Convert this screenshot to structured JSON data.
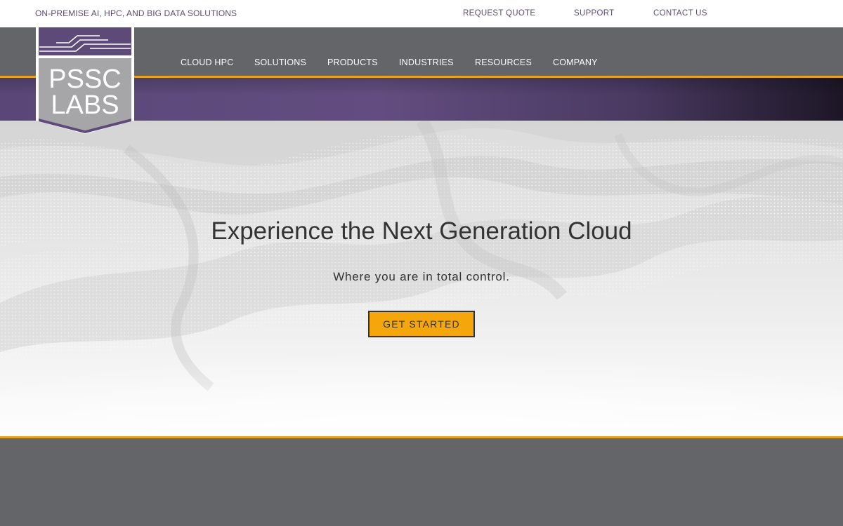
{
  "topbar": {
    "tagline": "ON-PREMISE AI, HPC, AND BIG DATA SOLUTIONS",
    "links": [
      "REQUEST QUOTE",
      "SUPPORT",
      "CONTACT US"
    ]
  },
  "logo": {
    "line1": "PSSC",
    "line2": "LABS"
  },
  "nav": {
    "items": [
      "CLOUD HPC",
      "SOLUTIONS",
      "PRODUCTS",
      "INDUSTRIES",
      "RESOURCES",
      "COMPANY"
    ]
  },
  "hero": {
    "title": "Experience the Next Generation Cloud",
    "subtitle": "Where you are in total control.",
    "cta_label": "GET STARTED"
  },
  "colors": {
    "brand_purple": "#5e4a78",
    "nav_gray": "#636569",
    "accent_gold": "#e6a21b",
    "button_orange": "#f5a60a"
  }
}
